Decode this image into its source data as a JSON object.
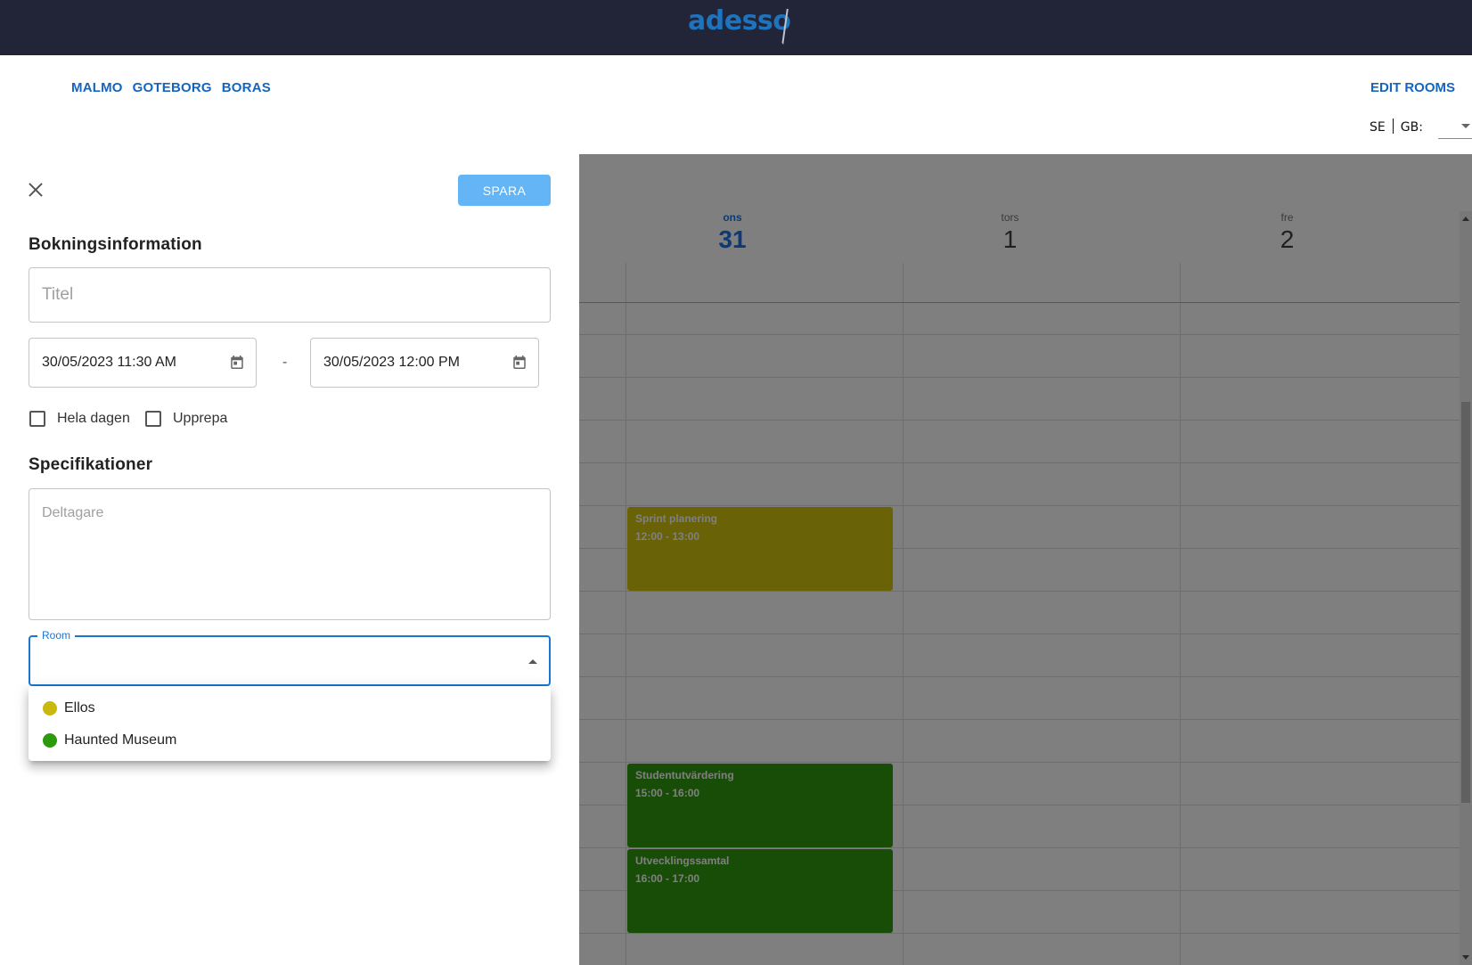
{
  "header": {
    "logo": "adesso",
    "cities": [
      "MALMO",
      "GOTEBORG",
      "BORAS"
    ],
    "edit_rooms": "EDIT ROOMS",
    "lang_se": "SE",
    "lang_gb": "GB:"
  },
  "calendar": {
    "days": [
      {
        "name": "ons",
        "number": "31",
        "today": true
      },
      {
        "name": "tors",
        "number": "1",
        "today": false
      },
      {
        "name": "fre",
        "number": "2",
        "today": false
      }
    ],
    "events": [
      {
        "title": "Sprint planering",
        "time": "12:00  -  13:00",
        "color": "#d4c50f"
      },
      {
        "title": "Studentutvärdering",
        "time": "15:00  -  16:00",
        "color": "#2f9b0f"
      },
      {
        "title": "Utvecklingssamtal",
        "time": "16:00  -  17:00",
        "color": "#2f9b0f"
      }
    ]
  },
  "drawer": {
    "save_label": "SPARA",
    "booking_info_title": "Bokningsinformation",
    "title_placeholder": "Titel",
    "start_datetime": "30/05/2023 11:30 AM",
    "date_separator": "-",
    "end_datetime": "30/05/2023 12:00 PM",
    "all_day_label": "Hela dagen",
    "repeat_label": "Upprepa",
    "specs_title": "Specifikationer",
    "participants_placeholder": "Deltagare",
    "room_label": "Room",
    "room_options": [
      {
        "label": "Ellos",
        "color": "#c9b80e"
      },
      {
        "label": "Haunted Museum",
        "color": "#2b9a0d"
      }
    ]
  },
  "icons": {
    "close": "close-icon",
    "calendar": "calendar-icon",
    "dropdown": "triangle-icon"
  }
}
